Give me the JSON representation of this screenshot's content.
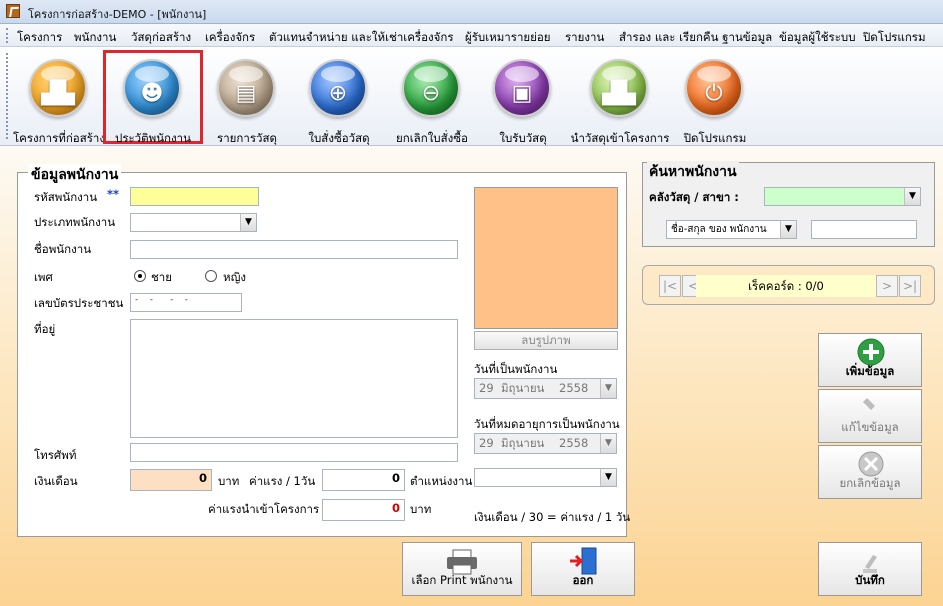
{
  "window": {
    "title": "โครงการก่อสร้าง-DEMO - [พนักงาน]"
  },
  "menu": [
    "โครงการ",
    "พนักงาน",
    "วัสดุก่อสร้าง",
    "เครื่องจักร",
    "ตัวแทนจำหน่าย และให้เช่าเครื่องจักร",
    "ผู้รับเหมารายย่อย",
    "รายงาน",
    "สำรอง และ เรียกคืน ฐานข้อมูล",
    "ข้อมูลผู้ใช้ระบบ",
    "ปิดโปรแกรม"
  ],
  "toolbar": [
    {
      "label": "โครงการที่ก่อสร้าง",
      "icon": "construction-project-icon",
      "color": "#f5a623"
    },
    {
      "label": "ประวัติพนักงาน",
      "icon": "employee-worker-icon",
      "color": "#2d8fd8",
      "selected": true
    },
    {
      "label": "รายการวัสดุ",
      "icon": "materials-icon",
      "color": "#b8a48c"
    },
    {
      "label": "ใบสั่งซื้อวัสดุ",
      "icon": "cart-add-icon",
      "color": "#2a6fd6"
    },
    {
      "label": "ยกเลิกใบสั่งซื้อ",
      "icon": "cart-remove-icon",
      "color": "#27a23a"
    },
    {
      "label": "ใบรับวัสดุ",
      "icon": "receive-box-icon",
      "color": "#8a3ab0"
    },
    {
      "label": "นำวัสดุเข้าโครงการ",
      "icon": "material-to-project-icon",
      "color": "#8bc34a"
    },
    {
      "label": "ปิดโปรแกรม",
      "icon": "power-icon",
      "color": "#f26b1d"
    }
  ],
  "employee": {
    "group_title": "ข้อมูลพนักงาน",
    "emp_id_label": "รหัสพนักงาน",
    "required_mark": "**",
    "emp_id_value": "",
    "type_label": "ประเภทพนักงาน",
    "type_value": "",
    "name_label": "ชื่อพนักงาน",
    "name_value": "",
    "gender_label": "เพศ",
    "gender_male": "ชาย",
    "gender_female": "หญิง",
    "idcard_label": "เลขบัตรประชาชน",
    "idcard_mask": "-    -      -    -",
    "address_label": "ที่อยู่",
    "address_value": "",
    "phone_label": "โทรศัพท์",
    "phone_value": "",
    "salary_label": "เงินเดือน",
    "salary_value": "0",
    "baht": "บาท",
    "daily_wage_label": "ค่าแรง / 1วัน",
    "daily_wage_value": "0",
    "position_label": "ตำแหน่งงาน",
    "position_value": "",
    "project_wage_label": "ค่าแรงนำเข้าโครงการ",
    "project_wage_value": "0",
    "delete_photo": "ลบรูปภาพ",
    "start_date_label": "วันที่เป็นพนักงาน",
    "start_date": {
      "day": "29",
      "month": "มิถุนายน",
      "year": "2558"
    },
    "end_date_label": "วันที่หมดอายุการเป็นพนักงาน",
    "end_date": {
      "day": "29",
      "month": "มิถุนายน",
      "year": "2558"
    },
    "formula_note": "เงินเดือน / 30 = ค่าแรง / 1 วัน"
  },
  "search": {
    "group_title": "ค้นหาพนักงาน",
    "warehouse_label": "คลังวัสดุ / สาขา :",
    "warehouse_value": "",
    "field_value": "ชื่อ-สกุล ของ พนักงาน",
    "keyword": ""
  },
  "navigator": {
    "record_text": "เร็คคอร์ด : 0/0"
  },
  "actions": {
    "add": "เพิ่มข้อมูล",
    "edit": "แก้ไขข้อมูล",
    "cancel": "ยกเลิกข้อมูล",
    "save": "บันทึก",
    "print": "เลือก Print พนักงาน",
    "exit": "ออก"
  },
  "colors": {
    "accent_selected": "#e0262d",
    "required_mark": "#1a3fd6",
    "photo_bg": "#ffc187"
  }
}
